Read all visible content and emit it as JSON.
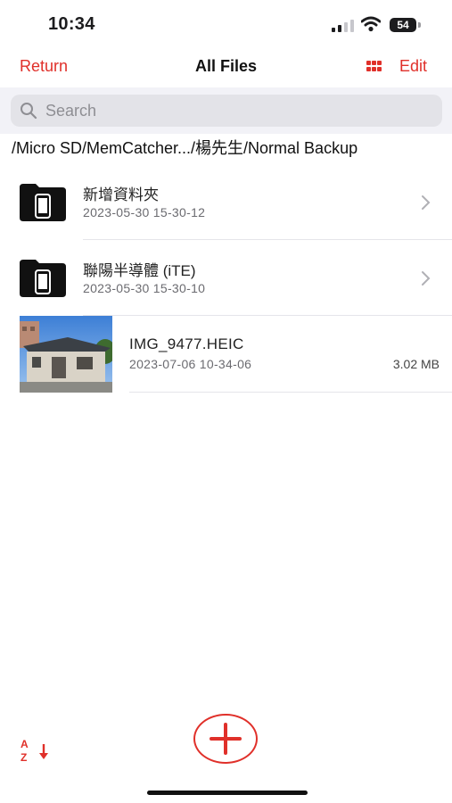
{
  "status": {
    "time": "10:34",
    "battery": "54"
  },
  "nav": {
    "back_label": "Return",
    "title": "All Files",
    "view_icon": "grid-icon",
    "edit_label": "Edit"
  },
  "search": {
    "placeholder": "Search"
  },
  "breadcrumb": {
    "path": "/Micro SD/MemCatcher.../楊先生/Normal Backup"
  },
  "items": [
    {
      "type": "folder",
      "name": "新增資料夾",
      "date": "2023-05-30 15-30-12"
    },
    {
      "type": "folder",
      "name": "聯陽半導體 (iTE)",
      "date": "2023-05-30 15-30-10"
    },
    {
      "type": "file",
      "name": "IMG_9477.HEIC",
      "date": "2023-07-06 10-34-06",
      "size": "3.02 MB"
    }
  ],
  "toolbar": {
    "sort_icon": "sort-az-icon",
    "add_icon": "plus-icon"
  },
  "colors": {
    "accent": "#e0302a",
    "background": "#ffffff",
    "search_bg": "#e3e3e8"
  }
}
